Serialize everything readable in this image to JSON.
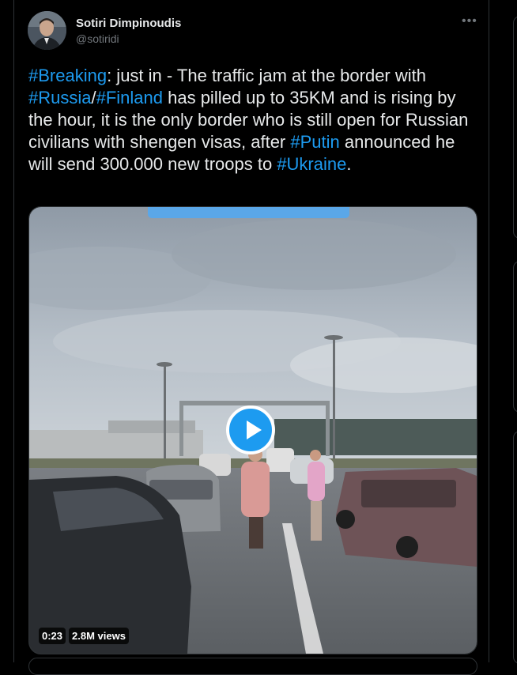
{
  "author": {
    "name": "Sotiri Dimpinoudis",
    "handle": "@sotiridi",
    "more_icon": "•••"
  },
  "tweet": {
    "segments": [
      {
        "text": "#Breaking",
        "tag": true
      },
      {
        "text": ": just in - The traffic jam at the border with ",
        "tag": false
      },
      {
        "text": "#Russia",
        "tag": true
      },
      {
        "text": "/",
        "tag": false
      },
      {
        "text": "#Finland",
        "tag": true
      },
      {
        "text": " has pilled up to 35KM and is rising by the hour, it is the only border who is still open for Russian civilians with shengen visas, after ",
        "tag": false
      },
      {
        "text": "#Putin",
        "tag": true
      },
      {
        "text": " announced he will send 300.000 new troops to ",
        "tag": false
      },
      {
        "text": "#Ukraine",
        "tag": true
      },
      {
        "text": ".",
        "tag": false
      }
    ]
  },
  "video": {
    "duration": "0:23",
    "views": "2.8M views"
  },
  "colors": {
    "background": "#000000",
    "text": "#e7e9ea",
    "secondary": "#71767b",
    "link": "#1d9bf0",
    "border": "#2f3336"
  }
}
